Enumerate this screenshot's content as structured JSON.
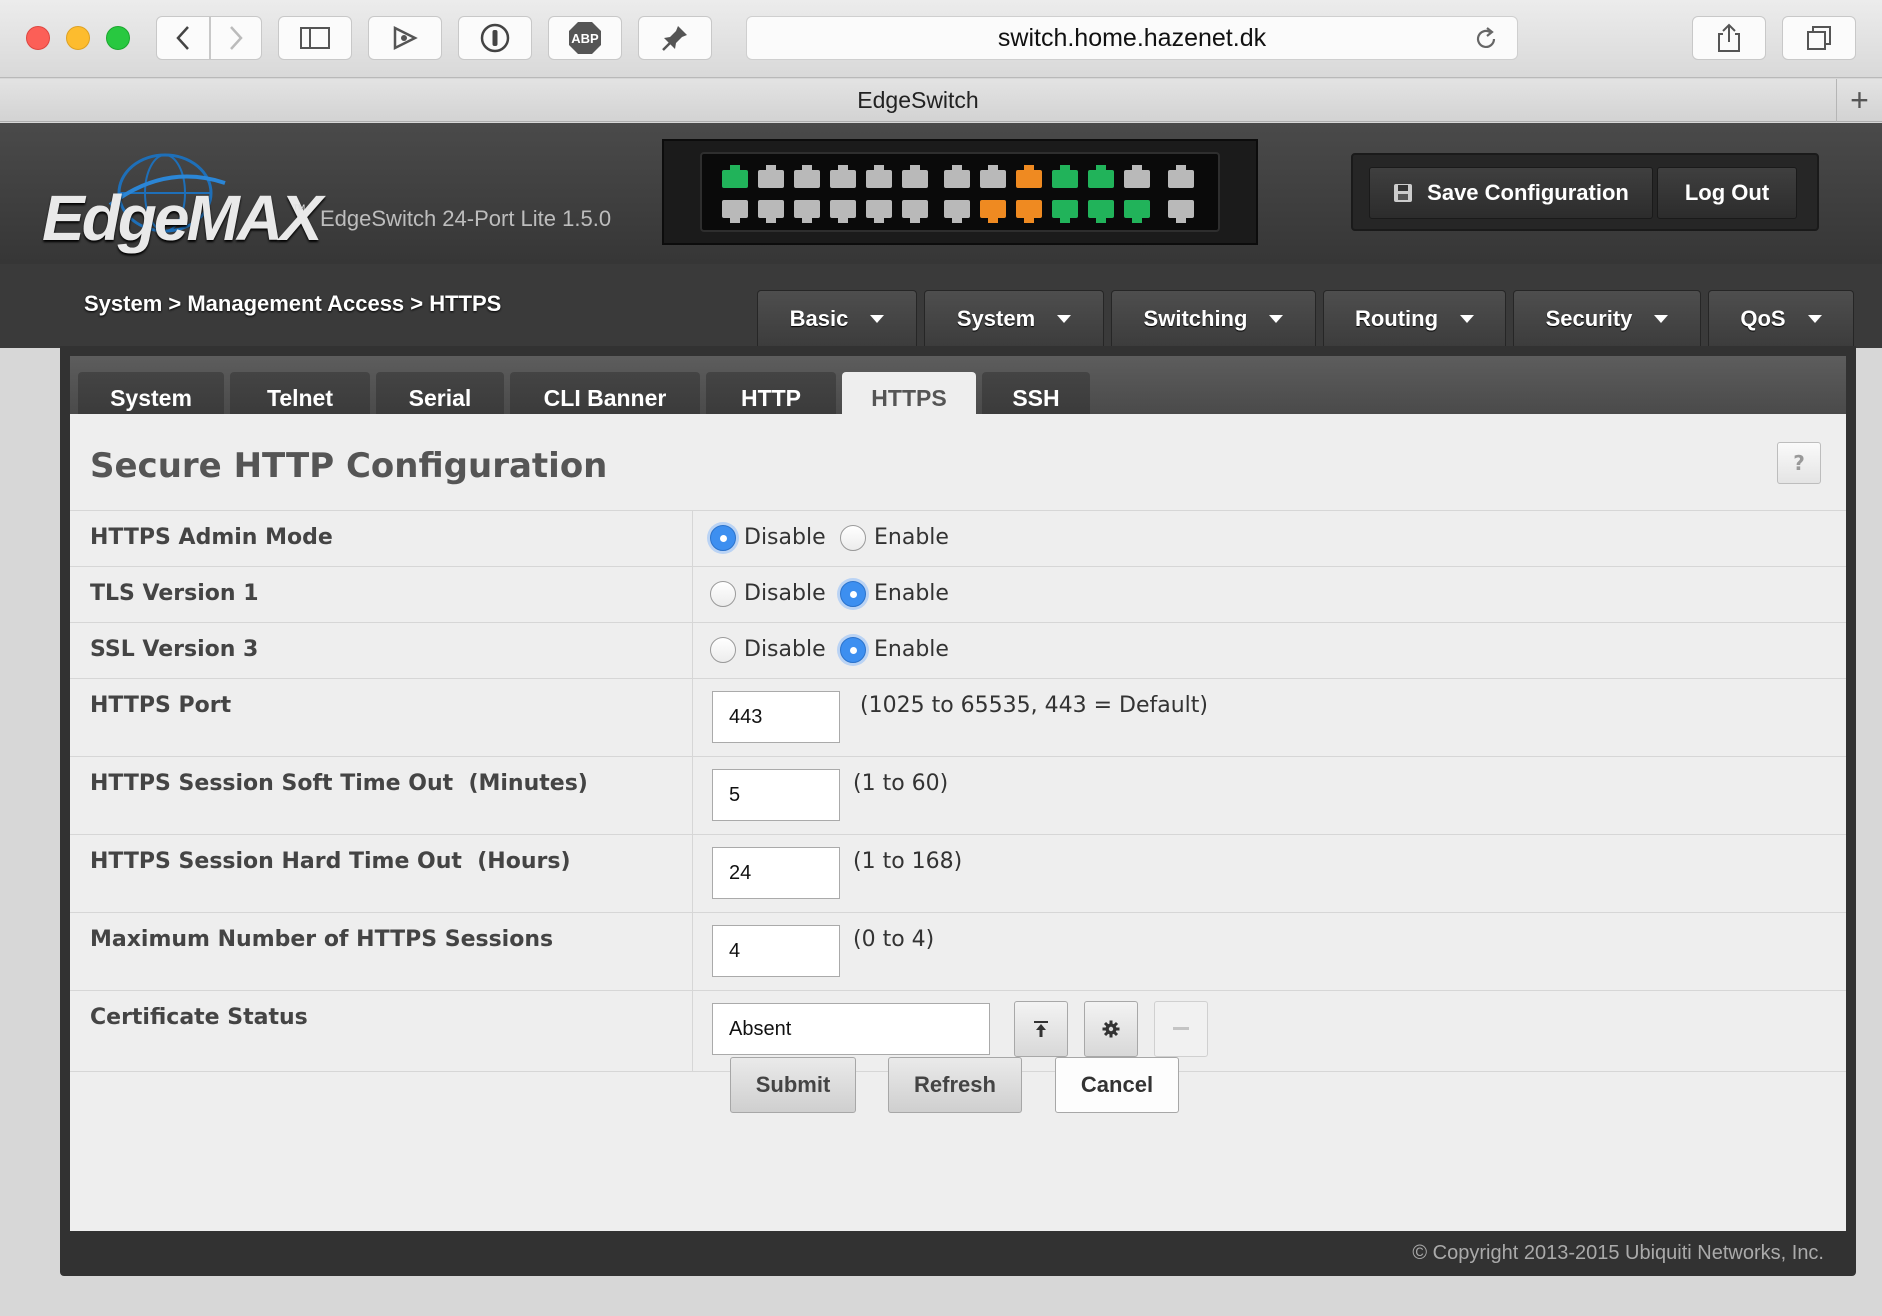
{
  "browser": {
    "url": "switch.home.hazenet.dk",
    "tab_title": "EdgeSwitch",
    "toolbar_icons": [
      "back-icon",
      "forward-icon",
      "sidebar-icon",
      "extension-icon",
      "password-icon",
      "adblock-icon",
      "pin-icon",
      "reload-icon",
      "share-icon",
      "tabs-icon"
    ],
    "adblock_label": "ABP",
    "new_tab_label": "+"
  },
  "header": {
    "brand": "EdgeMAX",
    "trademark": "™",
    "model": "EdgeSwitch 24-Port Lite 1.5.0",
    "save_label": "Save Configuration",
    "logout_label": "Log Out",
    "ports": {
      "top": [
        "green",
        "gray",
        "gray",
        "gray",
        "gray",
        "gray",
        "gray",
        "gray",
        "orange",
        "green",
        "green",
        "gray",
        "gray"
      ],
      "bottom": [
        "gray",
        "gray",
        "gray",
        "gray",
        "gray",
        "gray",
        "gray",
        "orange",
        "orange",
        "green",
        "green",
        "green",
        "gray"
      ]
    },
    "colors": {
      "green": "#21b35a",
      "orange": "#ef8a21",
      "gray": "#b9b9b9"
    }
  },
  "breadcrumb": "System > Management Access > HTTPS",
  "menus": [
    "Basic",
    "System",
    "Switching",
    "Routing",
    "Security",
    "QoS"
  ],
  "subtabs": [
    "System",
    "Telnet",
    "Serial",
    "CLI Banner",
    "HTTP",
    "HTTPS",
    "SSH"
  ],
  "active_subtab": "HTTPS",
  "section_title": "Secure HTTP Configuration",
  "help_label": "?",
  "rows": {
    "admin_mode": {
      "label": "HTTPS Admin Mode",
      "opt_disable": "Disable",
      "opt_enable": "Enable",
      "selected": "Disable"
    },
    "tls": {
      "label": "TLS Version 1",
      "opt_disable": "Disable",
      "opt_enable": "Enable",
      "selected": "Enable"
    },
    "ssl": {
      "label": "SSL Version 3",
      "opt_disable": "Disable",
      "opt_enable": "Enable",
      "selected": "Enable"
    },
    "port": {
      "label": "HTTPS Port",
      "value": "443",
      "hint": "(1025 to 65535, 443 = Default)"
    },
    "soft_timeout": {
      "label": "HTTPS Session Soft Time Out  (Minutes)",
      "value": "5",
      "hint": "(1 to 60)"
    },
    "hard_timeout": {
      "label": "HTTPS Session Hard Time Out  (Hours)",
      "value": "24",
      "hint": "(1 to 168)"
    },
    "max_sessions": {
      "label": "Maximum Number of HTTPS Sessions",
      "value": "4",
      "hint": "(0 to 4)"
    },
    "cert_status": {
      "label": "Certificate Status",
      "value": "Absent"
    }
  },
  "actions": {
    "submit": "Submit",
    "refresh": "Refresh",
    "cancel": "Cancel"
  },
  "footer": "© Copyright 2013-2015 Ubiquiti Networks, Inc."
}
